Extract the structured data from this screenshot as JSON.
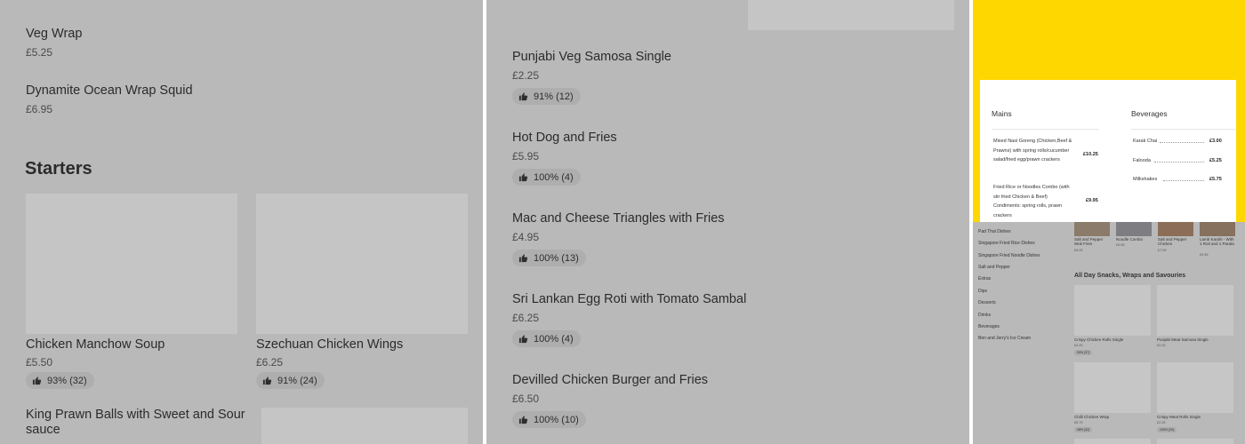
{
  "panel1": {
    "items_top": [
      {
        "name": "Veg Wrap",
        "price": "£5.25"
      },
      {
        "name": "Dynamite Ocean Wrap Squid",
        "price": "£6.95"
      }
    ],
    "section_title": "Starters",
    "starters": [
      {
        "name": "Chicken Manchow Soup",
        "price": "£5.50",
        "rating": "93% (32)"
      },
      {
        "name": "Szechuan Chicken Wings",
        "price": "£6.25",
        "rating": "91% (24)"
      },
      {
        "name": "King Prawn Balls with Sweet and Sour sauce"
      }
    ]
  },
  "panel2": {
    "items": [
      {
        "name": "Punjabi Veg Samosa Single",
        "price": "£2.25",
        "rating": "91% (12)"
      },
      {
        "name": "Hot Dog and Fries",
        "price": "£5.95",
        "rating": "100% (4)"
      },
      {
        "name": "Mac and Cheese Triangles with Fries",
        "price": "£4.95",
        "rating": "100% (13)"
      },
      {
        "name": "Sri Lankan Egg Roti with Tomato Sambal",
        "price": "£6.25",
        "rating": "100% (4)"
      },
      {
        "name": "Devilled Chicken Burger and Fries",
        "price": "£6.50",
        "rating": "100% (10)"
      }
    ]
  },
  "panel3": {
    "menu_card": {
      "mains_heading": "Mains",
      "beverages_heading": "Beverages",
      "main1_text": "Mixed Nasi Goreng (Chicken,Beef & Prawns) with spring rolls/cucumber salad/fried egg/prawn crackers",
      "main1_price": "£10.25",
      "main2_text": "Fried Rice or Noodles Combo (with stir fried Chicken & Beef) Condiments: spring rolls, prawn crackers",
      "main2_price": "£9.95",
      "beverages": [
        {
          "name": "Karak Chai",
          "price": "£3.00"
        },
        {
          "name": "Falooda",
          "price": "£5.25"
        },
        {
          "name": "Milkshakes",
          "price": "£5.75"
        }
      ]
    },
    "sidebar": [
      "Pad Thai Dishes",
      "Singapore Fried Rice Dishes",
      "Singapore Fried Noodle Dishes",
      "Salt and Pepper",
      "Extras",
      "Dips",
      "Desserts",
      "Drinks",
      "Beverages",
      "Ben and Jerry's Ice Cream"
    ],
    "top_row": [
      {
        "name": "Salt and Pepper Wok Fries",
        "price": "£5.25"
      },
      {
        "name": "Noodle Combo",
        "price": "£9.95"
      },
      {
        "name": "Salt and Pepper Chicken",
        "price": "£7.95"
      },
      {
        "name": "Lamb Karahi - With 1 Roti and 1 Parata",
        "price": "£9.95"
      }
    ],
    "section_title": "All Day Snacks, Wraps and Savouries",
    "grid": [
      {
        "name": "Crispy Chicken Rolls Single",
        "price": "£2.25",
        "rating": "90% (37)"
      },
      {
        "name": "Punjabi Meat Samosa Single",
        "price": "£2.25"
      },
      {
        "name": "Chilli Chicken Wrap",
        "price": "£5.75",
        "rating": "98% (32)"
      },
      {
        "name": "Crispy Meat Rolls Single",
        "price": "£2.25",
        "rating": "100% (20)"
      }
    ]
  }
}
